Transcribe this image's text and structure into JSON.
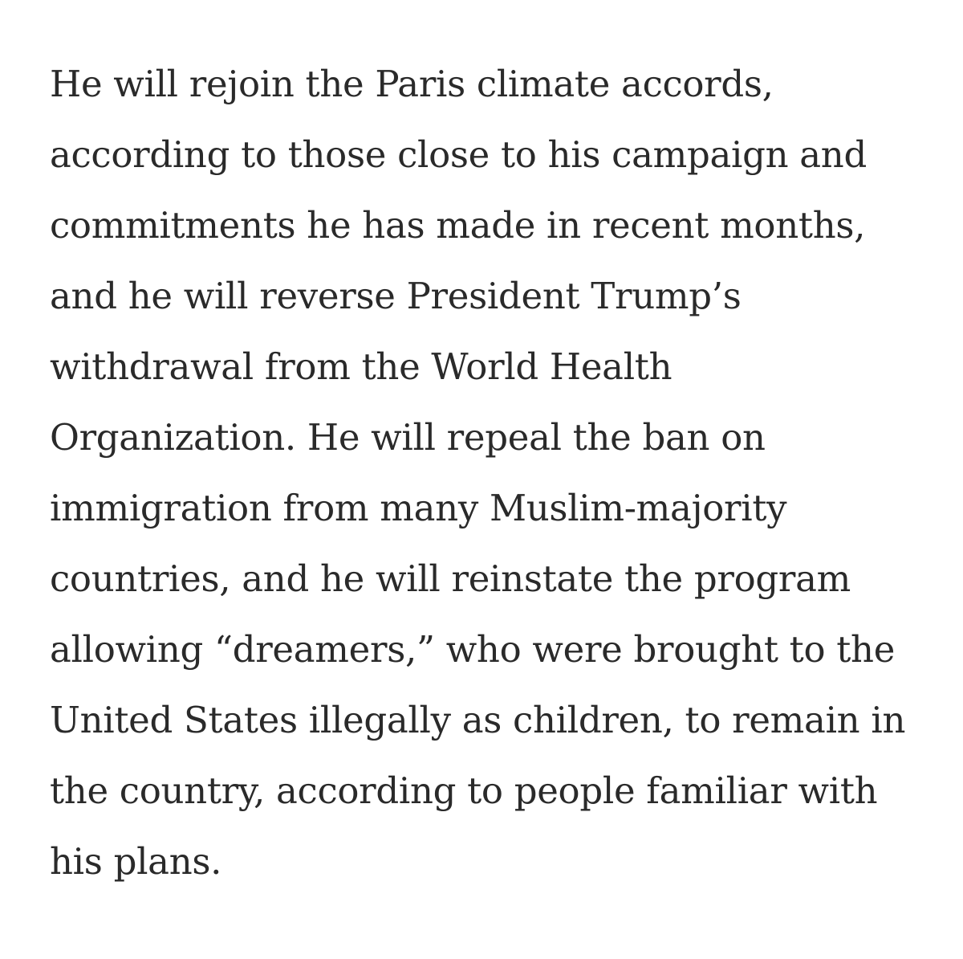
{
  "article": {
    "lines": [
      "He will rejoin the Paris climate accords,",
      "according to those close to his campaign and",
      "commitments he has made in recent months,",
      "and he will reverse President Trump’s",
      "withdrawal from the World Health",
      "Organization. He will repeal the ban on",
      "immigration from many Muslim-majority",
      "countries, and he will reinstate the program",
      "allowing “dreamers,” who were brought to the",
      "United States illegally as children, to remain in",
      "the country, according to people familiar with",
      "his plans."
    ],
    "text_color": "#2a2a2a",
    "background_color": "#ffffff"
  }
}
